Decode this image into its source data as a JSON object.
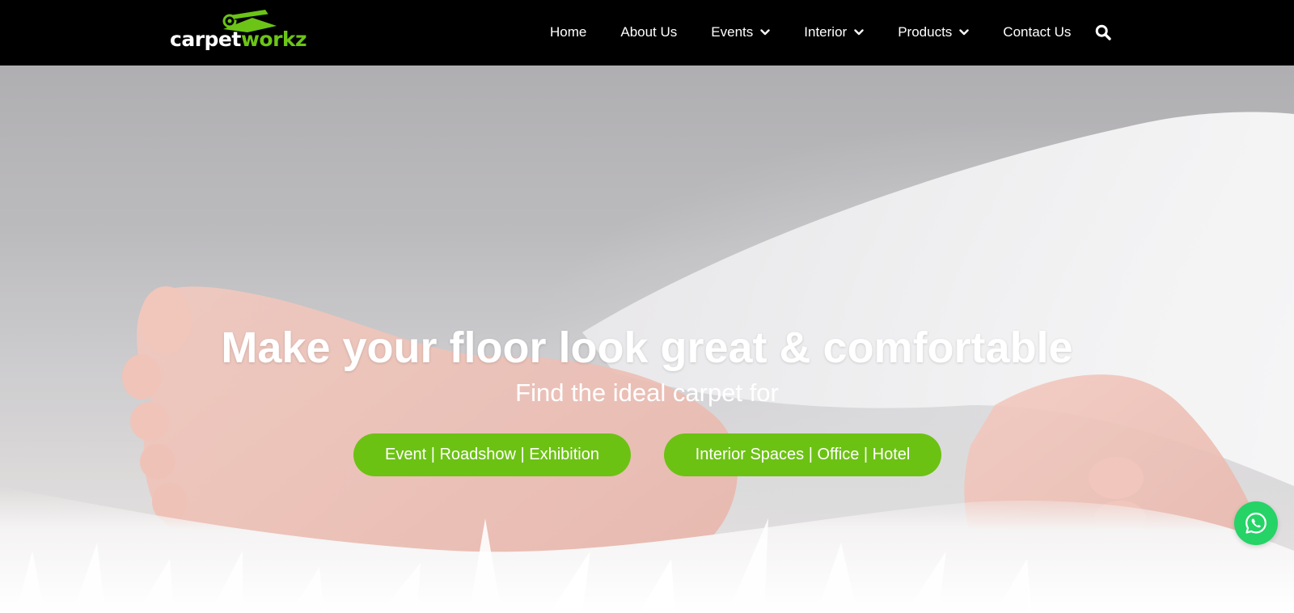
{
  "brand": {
    "logo_part1": "carpet",
    "logo_part2": "workz",
    "accent": "#6cc417"
  },
  "nav": {
    "items": [
      {
        "label": "Home",
        "dropdown": false
      },
      {
        "label": "About Us",
        "dropdown": false
      },
      {
        "label": "Events",
        "dropdown": true
      },
      {
        "label": "Interior",
        "dropdown": true
      },
      {
        "label": "Products",
        "dropdown": true
      },
      {
        "label": "Contact Us",
        "dropdown": false
      }
    ],
    "search_icon": "search-icon",
    "dropdown_icon": "chevron-down-icon"
  },
  "hero": {
    "title": "Make your floor look great & comfortable",
    "subtitle": "Find the ideal carpet for",
    "buttons": [
      {
        "label": "Event | Roadshow | Exhibition"
      },
      {
        "label": "Interior Spaces | Office | Hotel"
      }
    ],
    "button_color": "#6cc213"
  },
  "floating": {
    "whatsapp_icon": "whatsapp-icon",
    "whatsapp_color": "#25d366"
  }
}
